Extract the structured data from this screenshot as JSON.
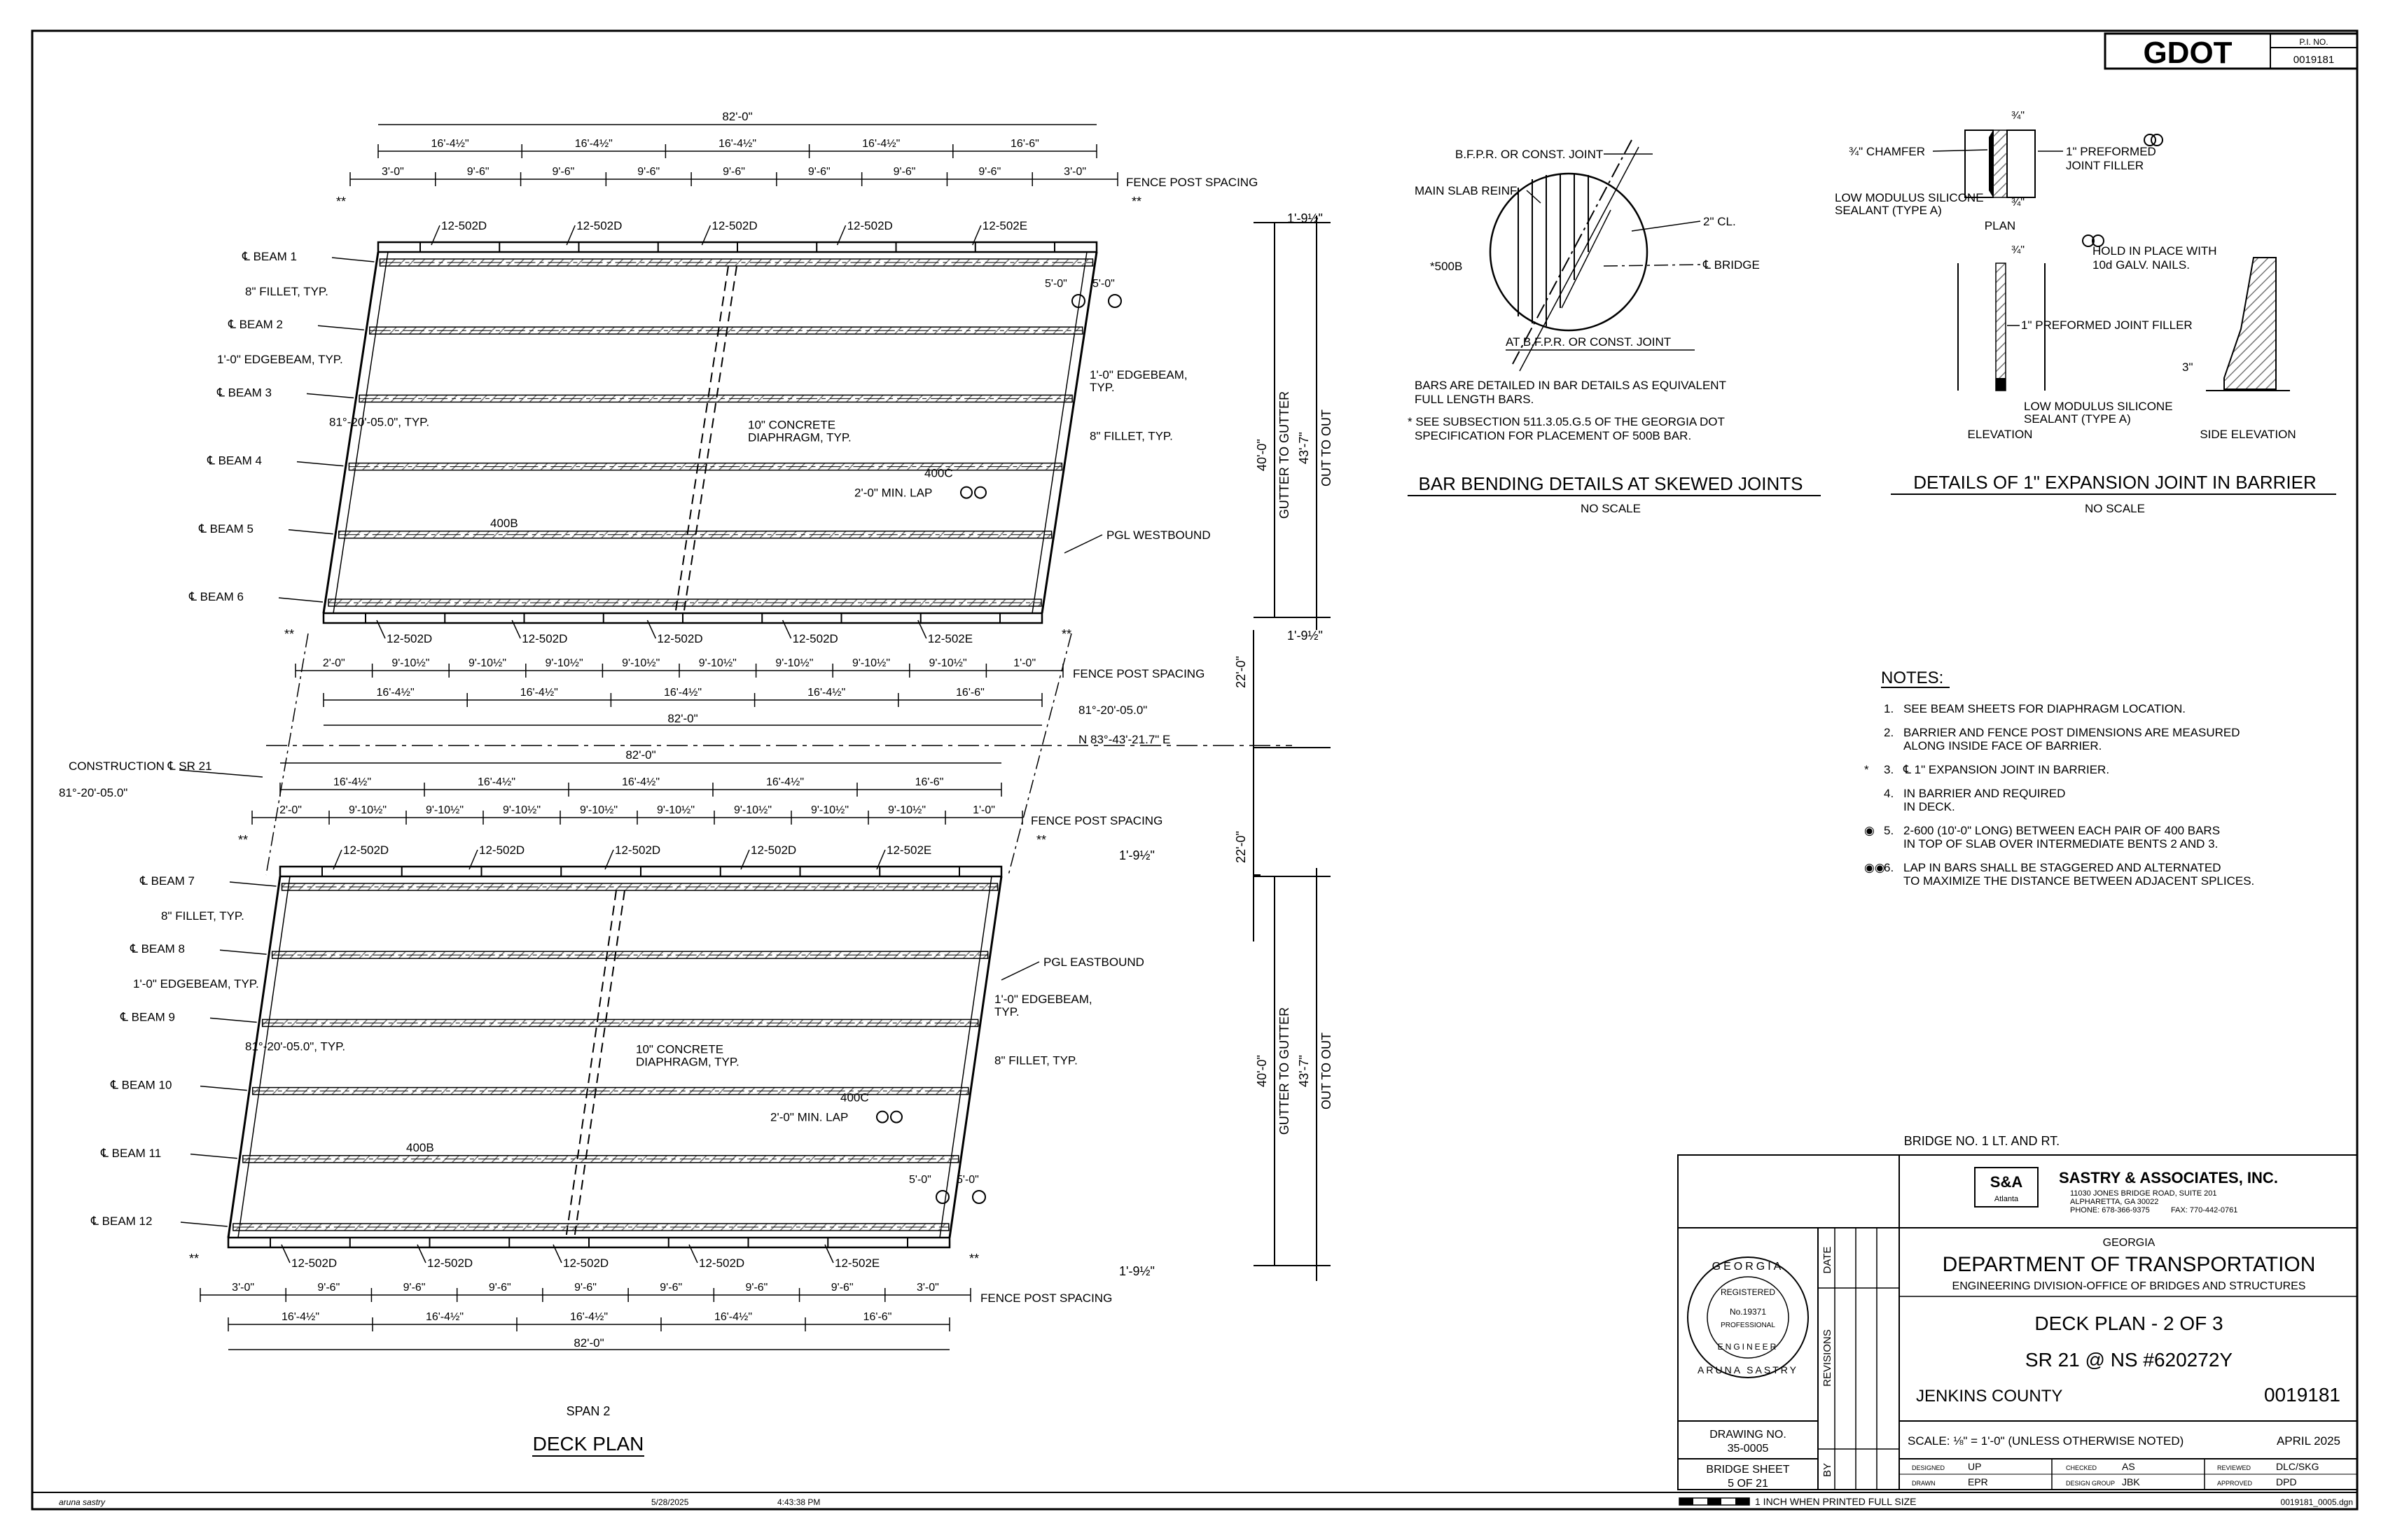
{
  "header": {
    "agency_logo": "GDOT",
    "pi_label": "P.I. NO.",
    "pi_number": "0019181"
  },
  "deck_plan": {
    "title": "DECK PLAN",
    "span_label": "SPAN 2",
    "overall_width": "82'-0\"",
    "westbound": {
      "top_dims": [
        "16'-4½\"",
        "16'-4½\"",
        "16'-4½\"",
        "16'-4½\"",
        "16'-6\""
      ],
      "post_spacing_top": [
        "3'-0\"",
        "9'-6\"",
        "9'-6\"",
        "9'-6\"",
        "9'-6\"",
        "9'-6\"",
        "9'-6\"",
        "9'-6\"",
        "3'-0\""
      ],
      "bar_labels_top": [
        "12-502D",
        "12-502D",
        "12-502D",
        "12-502D",
        "12-502E"
      ],
      "post_spacing_bottom": [
        "2'-0\"",
        "9'-10½\"",
        "9'-10½\"",
        "9'-10½\"",
        "9'-10½\"",
        "9'-10½\"",
        "9'-10½\"",
        "9'-10½\"",
        "9'-10½\"",
        "1'-0\""
      ],
      "bar_labels_bottom": [
        "12-502D",
        "12-502D",
        "12-502D",
        "12-502D",
        "12-502E"
      ],
      "bottom_dims": [
        "16'-4½\"",
        "16'-4½\"",
        "16'-4½\"",
        "16'-4½\"",
        "16'-6\""
      ],
      "beams": [
        "℄ BEAM 1",
        "℄ BEAM 2",
        "℄ BEAM 3",
        "℄ BEAM 4",
        "℄ BEAM 5",
        "℄ BEAM 6"
      ],
      "pgl": "PGL WESTBOUND"
    },
    "eastbound": {
      "top_dims": [
        "16'-4½\"",
        "16'-4½\"",
        "16'-4½\"",
        "16'-4½\"",
        "16'-6\""
      ],
      "post_spacing_top": [
        "2'-0\"",
        "9'-10½\"",
        "9'-10½\"",
        "9'-10½\"",
        "9'-10½\"",
        "9'-10½\"",
        "9'-10½\"",
        "9'-10½\"",
        "9'-10½\"",
        "1'-0\""
      ],
      "bar_labels_top": [
        "12-502D",
        "12-502D",
        "12-502D",
        "12-502D",
        "12-502E"
      ],
      "post_spacing_bottom": [
        "3'-0\"",
        "9'-6\"",
        "9'-6\"",
        "9'-6\"",
        "9'-6\"",
        "9'-6\"",
        "9'-6\"",
        "9'-6\"",
        "3'-0\""
      ],
      "bar_labels_bottom": [
        "12-502D",
        "12-502D",
        "12-502D",
        "12-502D",
        "12-502E"
      ],
      "bottom_dims": [
        "16'-4½\"",
        "16'-4½\"",
        "16'-4½\"",
        "16'-4½\"",
        "16'-6\""
      ],
      "beams": [
        "℄ BEAM 7",
        "℄ BEAM 8",
        "℄ BEAM 9",
        "℄ BEAM 10",
        "℄ BEAM 11",
        "℄ BEAM 12"
      ],
      "pgl": "PGL EASTBOUND"
    },
    "callouts": {
      "fence_post_spacing": "FENCE POST SPACING",
      "fillet_8": "8\" FILLET, TYP.",
      "edgebeam": "1'-0\" EDGEBEAM, TYP.",
      "edgebeam_right": "1'-0\" EDGEBEAM,",
      "typ": "TYP.",
      "skew_typ": "81°-20'-05.0\", TYP.",
      "diaphragm_1": "10\" CONCRETE",
      "diaphragm_2": "DIAPHRAGM, TYP.",
      "bar_400b": "400B",
      "bar_400c": "400C",
      "lap": "2'-0\" MIN. LAP",
      "gutter": "GUTTER TO GUTTER",
      "out_to_out": "OUT TO OUT",
      "width_gutter": "40'-0\"",
      "width_out": "43'-7\"",
      "overhang": "1'-9½\"",
      "gap": "22'-0\"",
      "five_ft": "5'-0\"",
      "construction_cl": "CONSTRUCTION ℄ SR 21",
      "skew": "81°-20'-05.0\"",
      "bearing": "N 83°-43'-21.7\" E",
      "star": "*",
      "double_star": "**"
    }
  },
  "bar_bending": {
    "title": "BAR BENDING DETAILS AT SKEWED JOINTS",
    "scale": "NO SCALE",
    "labels": {
      "bfpr": "B.F.P.R. OR CONST. JOINT",
      "main_reinf": "MAIN SLAB REINF.",
      "clear": "2\" CL.",
      "bridge_cl": "℄ BRIDGE",
      "bar": "*500B",
      "at_joint": "AT B.F.P.R. OR CONST. JOINT"
    },
    "note_1": "BARS ARE DETAILED IN BAR DETAILS AS EQUIVALENT",
    "note_2": "FULL LENGTH BARS.",
    "note_3": "* SEE SUBSECTION 511.3.05.G.5 OF THE GEORGIA DOT",
    "note_4": "SPECIFICATION FOR PLACEMENT OF 500B BAR."
  },
  "expansion_joint": {
    "title": "DETAILS OF 1\" EXPANSION JOINT IN BARRIER",
    "scale": "NO SCALE",
    "labels": {
      "three_quarter": "¾\"",
      "chamfer": "¾\" CHAMFER",
      "preformed": "1\" PREFORMED",
      "joint_filler": "JOINT FILLER",
      "low_mod_1": "LOW MODULUS SILICONE",
      "low_mod_2": "SEALANT (TYPE A)",
      "plan": "PLAN",
      "hold_1": "HOLD IN PLACE WITH",
      "hold_2": "10d GALV. NAILS.",
      "preformed_elev": "1\" PREFORMED JOINT FILLER",
      "three_in": "3\"",
      "elevation": "ELEVATION",
      "side_elevation": "SIDE ELEVATION"
    }
  },
  "notes": {
    "heading": "NOTES:",
    "items": [
      {
        "mark": "",
        "num": "1.",
        "lines": [
          "SEE BEAM SHEETS FOR DIAPHRAGM LOCATION."
        ]
      },
      {
        "mark": "",
        "num": "2.",
        "lines": [
          "BARRIER AND FENCE POST DIMENSIONS ARE MEASURED",
          "ALONG INSIDE FACE OF BARRIER."
        ]
      },
      {
        "mark": "*",
        "num": "3.",
        "lines": [
          "℄ 1\" EXPANSION JOINT IN BARRIER."
        ]
      },
      {
        "mark": "",
        "num": "4.",
        "lines": [
          "IN BARRIER AND REQUIRED",
          "IN DECK."
        ]
      },
      {
        "mark": "◉",
        "num": "5.",
        "lines": [
          "2-600 (10'-0\" LONG) BETWEEN EACH PAIR OF 400 BARS",
          "IN TOP OF SLAB OVER INTERMEDIATE BENTS 2 AND 3."
        ]
      },
      {
        "mark": "◉◉",
        "num": "6.",
        "lines": [
          "LAP IN BARS SHALL BE STAGGERED AND ALTERNATED",
          "TO MAXIMIZE THE DISTANCE BETWEEN ADJACENT SPLICES."
        ]
      }
    ]
  },
  "title_block": {
    "bridge": "BRIDGE NO. 1 LT. AND RT.",
    "firm_logo": "S&A",
    "firm_logo_sub": "Atlanta",
    "firm": "SASTRY & ASSOCIATES, INC.",
    "firm_addr_1": "11030 JONES BRIDGE ROAD, SUITE 201",
    "firm_addr_2": "ALPHARETTA, GA 30022",
    "firm_phone": "PHONE: 678-366-9375",
    "firm_fax": "FAX: 770-442-0761",
    "state": "GEORGIA",
    "department": "DEPARTMENT OF TRANSPORTATION",
    "division": "ENGINEERING DIVISION-OFFICE OF BRIDGES AND STRUCTURES",
    "sheet_title": "DECK PLAN - 2 OF 3",
    "route": "SR 21 @ NS #620272Y",
    "county": "JENKINS COUNTY",
    "project": "0019181",
    "scale": "SCALE: ⅛\" = 1'-0\" (UNLESS OTHERWISE NOTED)",
    "date": "APRIL 2025",
    "drawing_no_label": "DRAWING NO.",
    "drawing_no": "35-0005",
    "bridge_sheet_label": "BRIDGE SHEET",
    "bridge_sheet": "5  OF  21",
    "revisions": "REVISIONS",
    "date_col": "DATE",
    "by_col": "BY",
    "seal_top": "GEORGIA",
    "seal_reg": "REGISTERED",
    "seal_no": "No.19371",
    "seal_prof": "PROFESSIONAL",
    "seal_bottom": "ENGINEER",
    "seal_name": "ARUNA SASTRY",
    "designed_label": "DESIGNED",
    "designed": "UP",
    "checked_label": "CHECKED",
    "checked": "AS",
    "reviewed_label": "REVIEWED",
    "reviewed": "DLC/SKG",
    "drawn_label": "DRAWN",
    "drawn": "EPR",
    "design_group_label": "DESIGN GROUP",
    "design_group": "JBK",
    "approved_label": "APPROVED",
    "approved": "DPD",
    "inch_note": "1 INCH WHEN PRINTED FULL SIZE",
    "file": "0019181_0005.dgn"
  },
  "footer": {
    "user": "aruna sastry",
    "date": "5/28/2025",
    "time": "4:43:38 PM"
  }
}
